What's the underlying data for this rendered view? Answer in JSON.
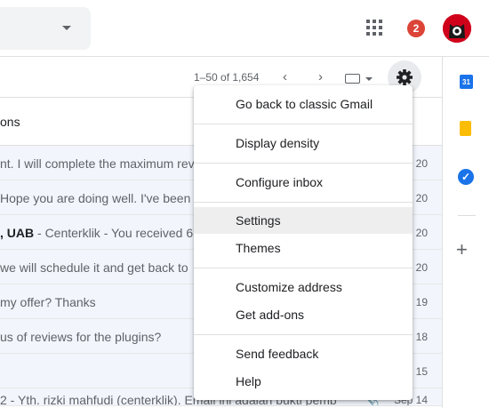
{
  "header": {
    "notification_count": "2",
    "accent_color": "#db4437"
  },
  "toolbar": {
    "pagination": "1–50 of 1,654",
    "prev_icon": "chevron-left-icon",
    "next_icon": "chevron-right-icon",
    "input_tools_icon": "keyboard-icon",
    "settings_icon": "gear-icon"
  },
  "category_label": "ons",
  "rows": [
    {
      "sender": "",
      "snippet": "nt. I will complete the maximum rev",
      "date": "20"
    },
    {
      "sender": "",
      "snippet": "Hope you are doing well. I've been tr",
      "date": "20"
    },
    {
      "sender": ", UAB",
      "snippet": " - Centerklik - You received 65,",
      "date": "20"
    },
    {
      "sender": "",
      "snippet": " we will schedule it and get back to",
      "date": "20"
    },
    {
      "sender": "",
      "snippet": " my offer? Thanks",
      "date": "19"
    },
    {
      "sender": "",
      "snippet": "us of reviews for the plugins?",
      "date": "18"
    },
    {
      "sender": "",
      "snippet": "",
      "date": "15"
    },
    {
      "sender": "",
      "snippet": "2 - Yth. rizki mahfudi (centerklik). Email ini adalah bukti pemb",
      "date": "Sep 14"
    }
  ],
  "side_panel": {
    "calendar_label": "31"
  },
  "menu": {
    "items": [
      {
        "label": "Go back to classic Gmail"
      },
      {
        "label": "Display density"
      },
      {
        "label": "Configure inbox"
      },
      {
        "label": "Settings"
      },
      {
        "label": "Themes"
      },
      {
        "label": "Customize address"
      },
      {
        "label": "Get add-ons"
      },
      {
        "label": "Send feedback"
      },
      {
        "label": "Help"
      }
    ],
    "highlighted": "Settings"
  }
}
